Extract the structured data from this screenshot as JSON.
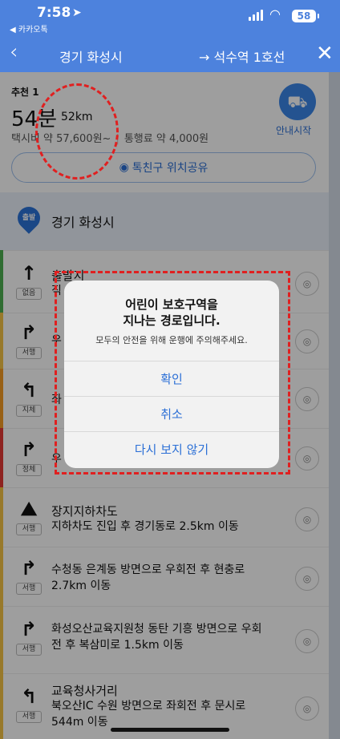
{
  "status_bar": {
    "time": "7:58",
    "back_app": "◀ 카카오톡",
    "battery": "58"
  },
  "header": {
    "origin": "경기 화성시",
    "destination": "→ 석수역 1호선"
  },
  "summary": {
    "recommendation": "추천 1",
    "duration": "54분",
    "distance": "52km",
    "taxi_fare": "택시비 약 57,600원~",
    "toll_fare": "통행료 약 4,000원",
    "navigate_label": "안내시작",
    "share_label": "톡친구 위치공유"
  },
  "start": {
    "badge": "출발",
    "name": "경기 화성시"
  },
  "steps": [
    {
      "icon": "arrow-up-icon",
      "tag": "없음",
      "title": "출발지",
      "desc": "직"
    },
    {
      "icon": "turn-right-icon",
      "tag": "서행",
      "title": "",
      "desc": "우"
    },
    {
      "icon": "turn-left-icon",
      "tag": "지체",
      "title": "",
      "desc": "좌"
    },
    {
      "icon": "turn-right-icon",
      "tag": "정체",
      "title": "",
      "desc": "우"
    },
    {
      "icon": "underpass-icon",
      "tag": "서행",
      "title": "장지지하차도",
      "desc": "지하차도 진입 후 경기동로 2.5km 이동"
    },
    {
      "icon": "turn-right-icon",
      "tag": "서행",
      "title": "",
      "desc": "수청동 은계동 방면으로 우회전 후 현충로 2.7km 이동"
    },
    {
      "icon": "turn-right-icon",
      "tag": "서행",
      "title": "",
      "desc": "화성오산교육지원청 동탄 기흥 방면으로 우회전 후 복삼미로 1.5km 이동"
    },
    {
      "icon": "turn-left-icon",
      "tag": "서행",
      "title": "교육청사거리",
      "desc": "북오산IC 수원 방면으로 좌회전 후 문시로 544m 이동"
    }
  ],
  "dialog": {
    "title_line1": "어린이 보호구역을",
    "title_line2": "지나는 경로입니다.",
    "message": "모두의 안전을 위해 운행에 주의해주세요.",
    "confirm": "확인",
    "cancel": "취소",
    "dont_show": "다시 보지 않기"
  },
  "colors": {
    "brand_blue": "#4d82dd",
    "accent_blue": "#2b6fd6",
    "traffic_green": "#4caf50",
    "traffic_yellow": "#f6c445",
    "traffic_orange": "#f59b23",
    "traffic_red": "#e53935",
    "annotation_red": "#e02020"
  }
}
